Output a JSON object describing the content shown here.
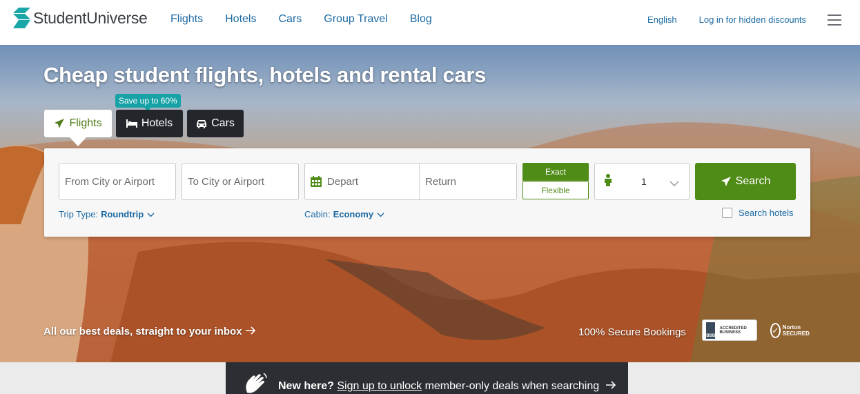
{
  "header": {
    "brand": "StudentUniverse",
    "nav": [
      "Flights",
      "Hotels",
      "Cars",
      "Group Travel",
      "Blog"
    ],
    "language": "English",
    "login": "Log in for hidden discounts"
  },
  "hero": {
    "title": "Cheap student flights, hotels and rental cars",
    "tabs": {
      "flights": "Flights",
      "hotels": "Hotels",
      "cars": "Cars"
    },
    "promo_badge": "Save up to 60%"
  },
  "search": {
    "from_placeholder": "From City or Airport",
    "to_placeholder": "To City or Airport",
    "depart_placeholder": "Depart",
    "return_placeholder": "Return",
    "exact_label": "Exact",
    "flexible_label": "Flexible",
    "passengers": "1",
    "search_label": "Search",
    "trip_type_label": "Trip Type:",
    "trip_type_value": "Roundtrip",
    "cabin_label": "Cabin:",
    "cabin_value": "Economy",
    "search_hotels_label": "Search hotels"
  },
  "footer_hero": {
    "inbox_link": "All our best deals, straight to your inbox",
    "secure_text": "100% Secure Bookings",
    "bbb_text": "ACCREDITED BUSINESS",
    "bbb_mark": "BBB",
    "norton_text": "Norton SECURED"
  },
  "banner": {
    "bold": "New here?",
    "link": "Sign up to unlock",
    "rest": "member-only deals when searching"
  },
  "colors": {
    "brand_green": "#4f8b17",
    "link_blue": "#1c6aa3",
    "dark_tab": "#23272c",
    "promo_teal": "#17a2a6"
  }
}
